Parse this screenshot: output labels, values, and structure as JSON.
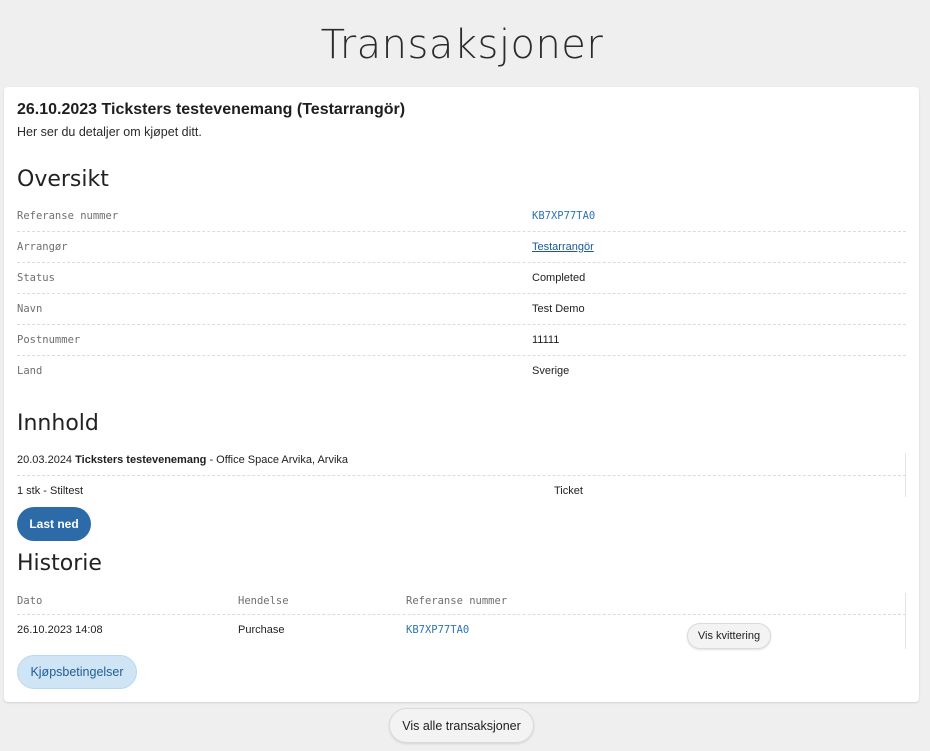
{
  "page": {
    "title": "Transaksjoner"
  },
  "purchase": {
    "title": "26.10.2023 Ticksters testevenemang (Testarrangör)",
    "subtitle": "Her ser du detaljer om kjøpet ditt."
  },
  "overview": {
    "heading": "Oversikt",
    "rows": [
      {
        "label": "Referanse nummer",
        "value": "KB7XP77TA0"
      },
      {
        "label": "Arrangør",
        "value": "Testarrangör"
      },
      {
        "label": "Status",
        "value": "Completed"
      },
      {
        "label": "Navn",
        "value": "Test Demo"
      },
      {
        "label": "Postnummer",
        "value": "11111"
      },
      {
        "label": "Land",
        "value": "Sverige"
      }
    ]
  },
  "contents": {
    "heading": "Innhold",
    "event_date": "20.03.2024",
    "event_name": "Ticksters testevenemang",
    "event_venue": " - Office Space Arvika, Arvika",
    "item_description": "1 stk - Stiltest",
    "item_type": "Ticket",
    "download_label": "Last ned"
  },
  "history": {
    "heading": "Historie",
    "columns": [
      "Dato",
      "Hendelse",
      "Referanse nummer"
    ],
    "rows": [
      {
        "date": "26.10.2023 14:08",
        "event": "Purchase",
        "reference": "KB7XP77TA0",
        "receipt_label": "Vis kvittering"
      }
    ]
  },
  "terms_label": "Kjøpsbetingelser",
  "view_all_label": "Vis alle transaksjoner",
  "colors": {
    "background": "#efefef",
    "card": "#ffffff",
    "primary_button": "#2d6aa8",
    "link": "#2f74b5",
    "terms_button": "#cfe5f6"
  }
}
